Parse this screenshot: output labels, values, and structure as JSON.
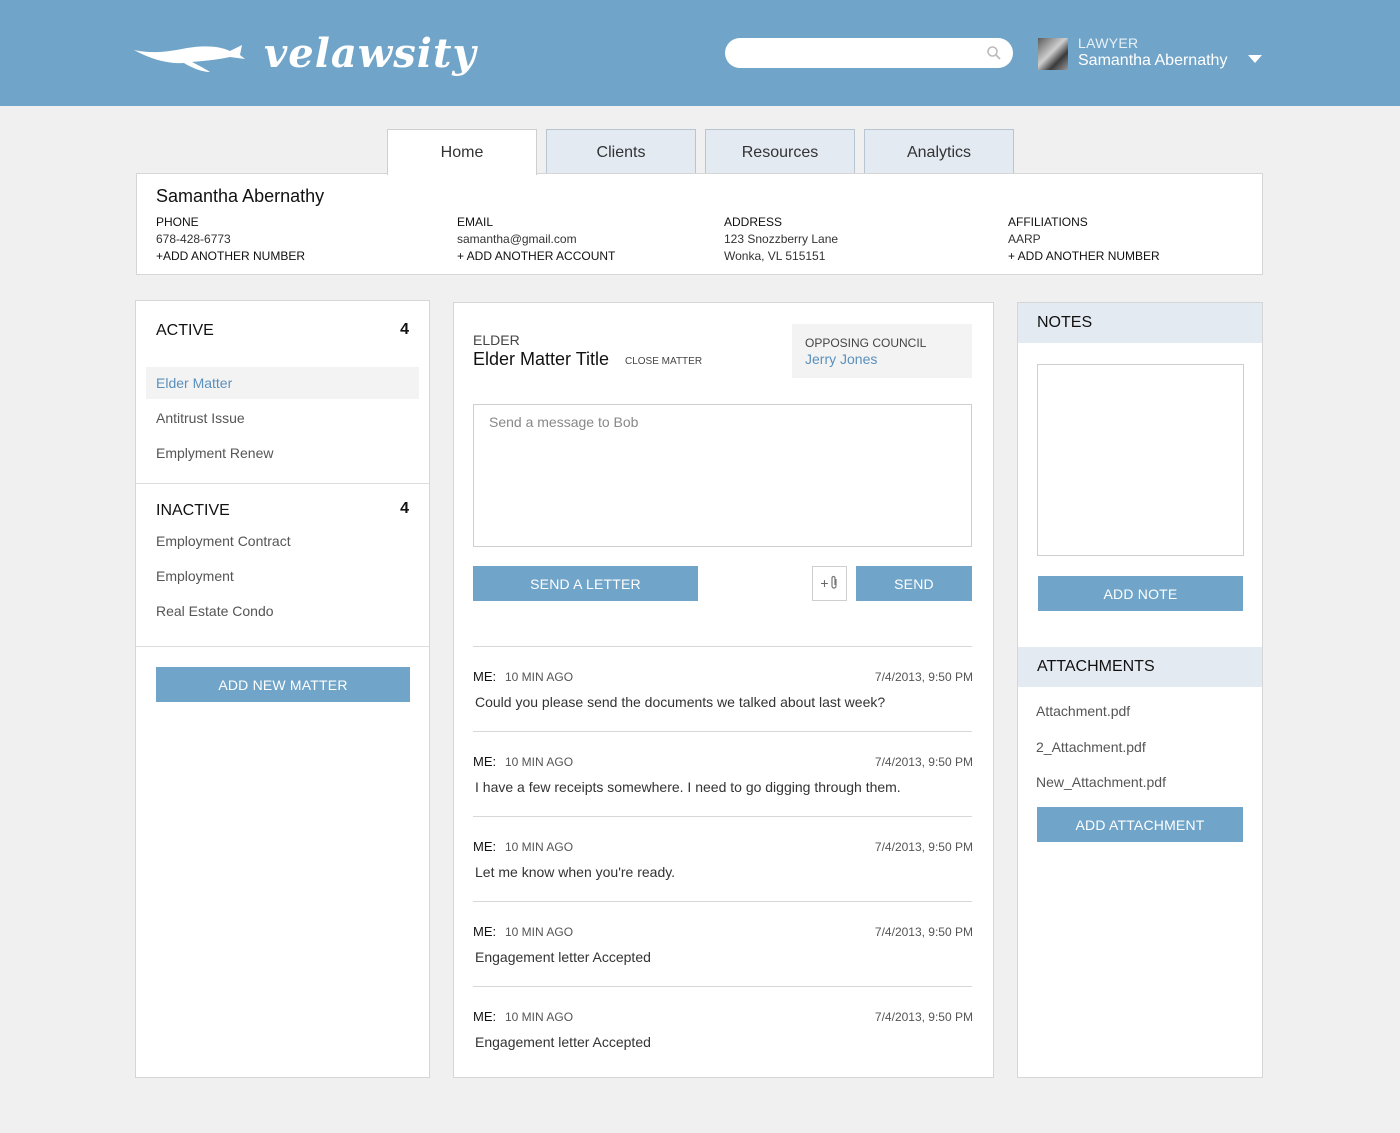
{
  "header": {
    "logo_text": "velawsity",
    "search_placeholder": "",
    "user": {
      "role": "LAWYER",
      "name": "Samantha Abernathy"
    }
  },
  "tabs": [
    {
      "label": "Home",
      "active": true
    },
    {
      "label": "Clients"
    },
    {
      "label": "Resources"
    },
    {
      "label": "Analytics"
    }
  ],
  "profile": {
    "name": "Samantha Abernathy",
    "phone": {
      "label": "PHONE",
      "value": "678-428-6773",
      "add": "+ADD ANOTHER NUMBER"
    },
    "email": {
      "label": "EMAIL",
      "value": "samantha@gmail.com",
      "add": "+ ADD ANOTHER ACCOUNT"
    },
    "address": {
      "label": "ADDRESS",
      "line1": "123 Snozzberry Lane",
      "line2": "Wonka, VL 515151"
    },
    "affiliations": {
      "label": "AFFILIATIONS",
      "value": "AARP",
      "add": "+ ADD ANOTHER NUMBER"
    }
  },
  "matters": {
    "active": {
      "title": "ACTIVE",
      "count": "4",
      "items": [
        "Elder Matter",
        "Antitrust Issue",
        "Emplyment Renew"
      ]
    },
    "inactive": {
      "title": "INACTIVE",
      "count": "4",
      "items": [
        "Employment Contract",
        "Employment",
        "Real Estate Condo"
      ]
    },
    "add_button": "ADD NEW MATTER"
  },
  "matter_detail": {
    "category": "ELDER",
    "title": "Elder Matter Title",
    "close_label": "CLOSE MATTER",
    "opposing_label": "OPPOSING COUNCIL",
    "opposing_name": "Jerry Jones",
    "message_placeholder": "Send a message to Bob",
    "send_letter": "SEND A LETTER",
    "attach_label": "+",
    "send": "SEND",
    "messages": [
      {
        "sender": "ME:",
        "ago": "10 MIN AGO",
        "timestamp": "7/4/2013, 9:50 PM",
        "text": "Could you please send the documents we talked about last week?"
      },
      {
        "sender": "ME:",
        "ago": "10 MIN AGO",
        "timestamp": "7/4/2013, 9:50 PM",
        "text": "I have a few receipts somewhere. I need to go digging through them."
      },
      {
        "sender": "ME:",
        "ago": "10 MIN AGO",
        "timestamp": "7/4/2013, 9:50 PM",
        "text": "Let me know when you're ready."
      },
      {
        "sender": "ME:",
        "ago": "10 MIN AGO",
        "timestamp": "7/4/2013, 9:50 PM",
        "text": "Engagement letter Accepted"
      },
      {
        "sender": "ME:",
        "ago": "10 MIN AGO",
        "timestamp": "7/4/2013, 9:50 PM",
        "text": "Engagement letter Accepted"
      }
    ]
  },
  "notes": {
    "title": "NOTES",
    "add_button": "ADD NOTE"
  },
  "attachments": {
    "title": "ATTACHMENTS",
    "items": [
      "Attachment.pdf",
      "2_Attachment.pdf",
      "New_Attachment.pdf"
    ],
    "add_button": "ADD ATTACHMENT"
  },
  "colors": {
    "header": "#70a4c8",
    "accent": "#70a4c8",
    "link": "#5a90bd",
    "tab_bg": "#e3eaf2"
  }
}
